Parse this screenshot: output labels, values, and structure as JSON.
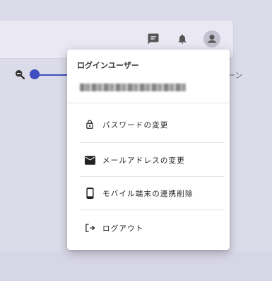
{
  "menu": {
    "header": "ログインユーザー",
    "items": [
      {
        "label": "パスワードの変更",
        "icon": "lock-icon"
      },
      {
        "label": "メールアドレスの変更",
        "icon": "mail-icon"
      },
      {
        "label": "モバイル端末の連携削除",
        "icon": "mobile-icon"
      },
      {
        "label": "ログアウト",
        "icon": "logout-icon"
      }
    ]
  },
  "toolbar": {
    "icons": [
      "feedback-icon",
      "bell-icon",
      "account-icon"
    ]
  },
  "background": {
    "partial_text": "ーン"
  },
  "colors": {
    "accent": "#3f4fbf",
    "icon": "#555555",
    "page_bg": "#dcdbe9"
  }
}
